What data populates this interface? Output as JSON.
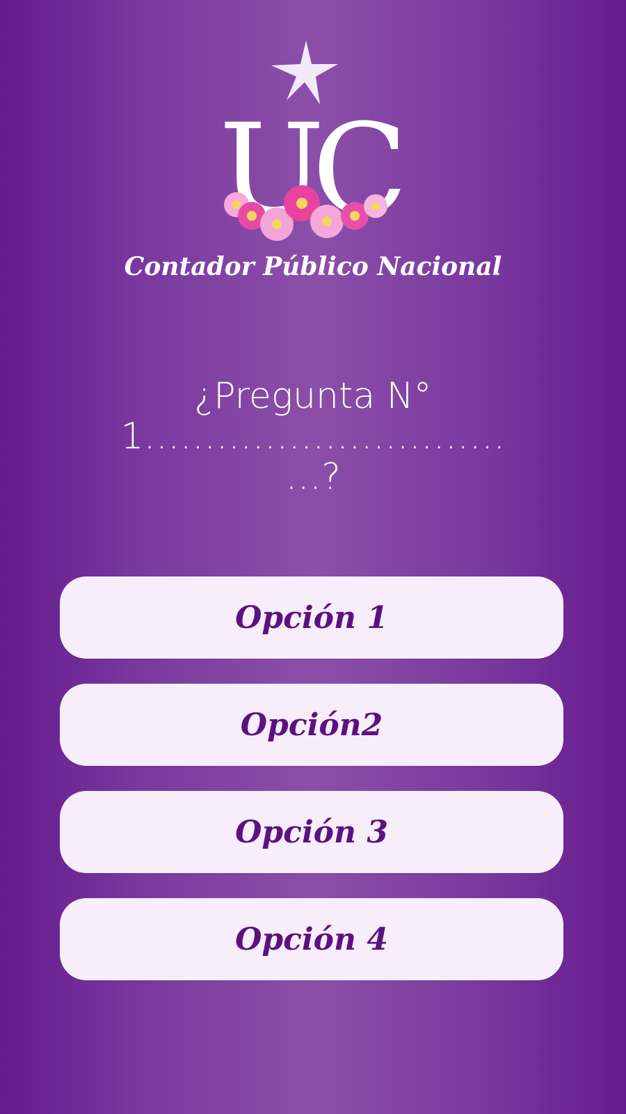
{
  "brand": {
    "logo_letters": "UC",
    "caption": "Contador Público Nacional",
    "icons": [
      "star-icon",
      "flowers-icon"
    ]
  },
  "question": {
    "text": "¿Pregunta N° 1……………………………?"
  },
  "options": [
    {
      "label": "Opción 1"
    },
    {
      "label": "Opción2"
    },
    {
      "label": "Opción 3"
    },
    {
      "label": "Opción 4"
    }
  ],
  "colors": {
    "background_edge": "#651a8e",
    "background_center": "#8b4fa8",
    "button_background": "#f8eefb",
    "button_text": "#5b1280",
    "text_light": "#ffffff"
  }
}
